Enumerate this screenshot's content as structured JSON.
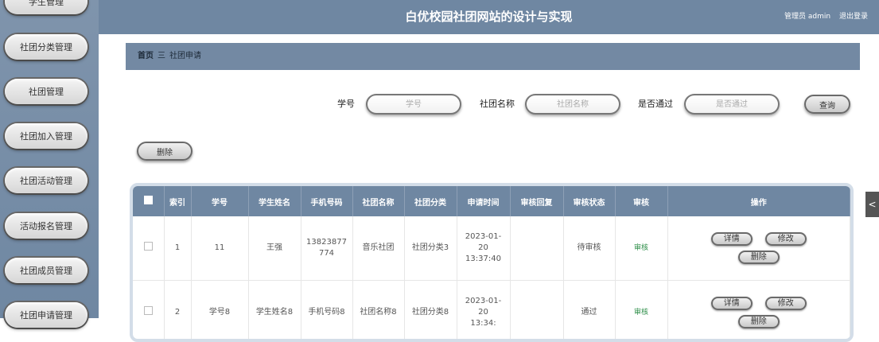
{
  "header": {
    "title": "白优校园社团网站的设计与实现",
    "admin": "管理员 admin",
    "logout": "退出登录"
  },
  "sidebar": {
    "items": [
      {
        "label": "学生管理"
      },
      {
        "label": "社团分类管理"
      },
      {
        "label": "社团管理"
      },
      {
        "label": "社团加入管理"
      },
      {
        "label": "社团活动管理"
      },
      {
        "label": "活动报名管理"
      },
      {
        "label": "社团成员管理"
      },
      {
        "label": "社团申请管理"
      }
    ]
  },
  "breadcrumb": {
    "home": "首页",
    "sep": "三",
    "current": "社团申请"
  },
  "search": {
    "student_no_label": "学号",
    "student_no_placeholder": "学号",
    "club_label": "社团名称",
    "club_placeholder": "社团名称",
    "pass_label": "是否通过",
    "pass_placeholder": "是否通过",
    "query_button": "查询"
  },
  "toolbar": {
    "delete_button": "删除"
  },
  "table": {
    "headers": [
      "索引",
      "学号",
      "学生姓名",
      "手机号码",
      "社团名称",
      "社团分类",
      "申请时间",
      "审核回复",
      "审核状态",
      "审核",
      "操作"
    ],
    "rows": [
      {
        "index": "1",
        "student_no": "11",
        "name": "王强",
        "phone": "13823877774",
        "club": "音乐社团",
        "category": "社团分类3",
        "time": "2023-01-20 13:37:40",
        "reply": "",
        "status": "待审核",
        "audit": "审核",
        "detail": "详情",
        "edit": "修改",
        "delete": "删除"
      },
      {
        "index": "2",
        "student_no": "学号8",
        "name": "学生姓名8",
        "phone": "手机号码8",
        "club": "社团名称8",
        "category": "社团分类8",
        "time": "2023-01-20 13:34:",
        "reply": "",
        "status": "通过",
        "audit": "审核",
        "detail": "详情",
        "edit": "修改",
        "delete": "删除"
      }
    ]
  },
  "side_handle": "<"
}
